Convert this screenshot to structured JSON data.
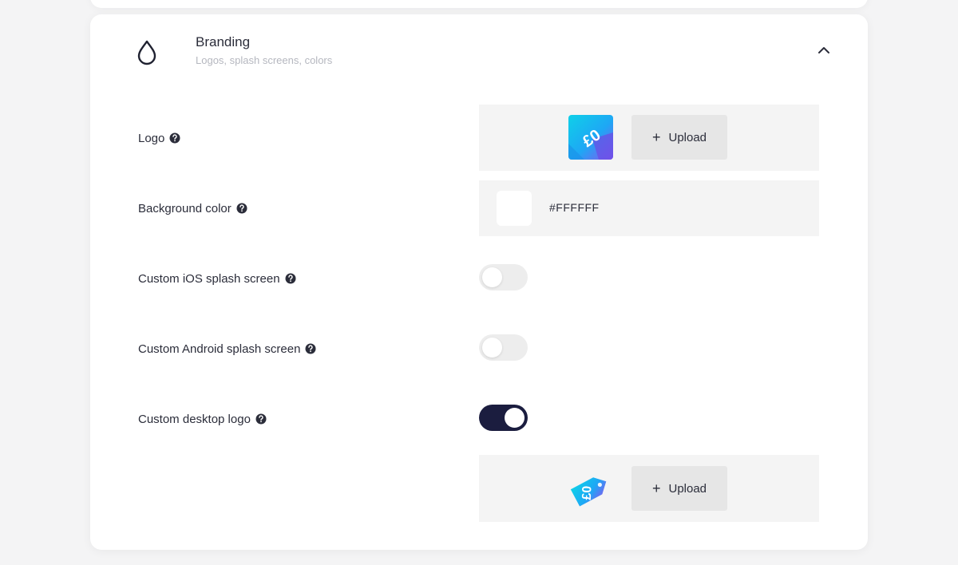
{
  "section": {
    "title": "Branding",
    "subtitle": "Logos, splash screens, colors"
  },
  "rows": {
    "logo": {
      "label": "Logo"
    },
    "background_color": {
      "label": "Background color",
      "value": "#FFFFFF"
    },
    "ios_splash": {
      "label": "Custom iOS splash screen",
      "enabled": false
    },
    "android_splash": {
      "label": "Custom Android splash screen",
      "enabled": false
    },
    "desktop_logo": {
      "label": "Custom desktop logo",
      "enabled": true
    }
  },
  "upload": {
    "label": "Upload"
  },
  "colors": {
    "toggle_on": "#1b1d3f",
    "toggle_off": "#ededed",
    "panel": "#f4f4f4"
  },
  "icons": {
    "section": "drop-icon",
    "collapse": "chevron-up-icon",
    "help": "help-circle-icon",
    "add": "plus-icon"
  }
}
